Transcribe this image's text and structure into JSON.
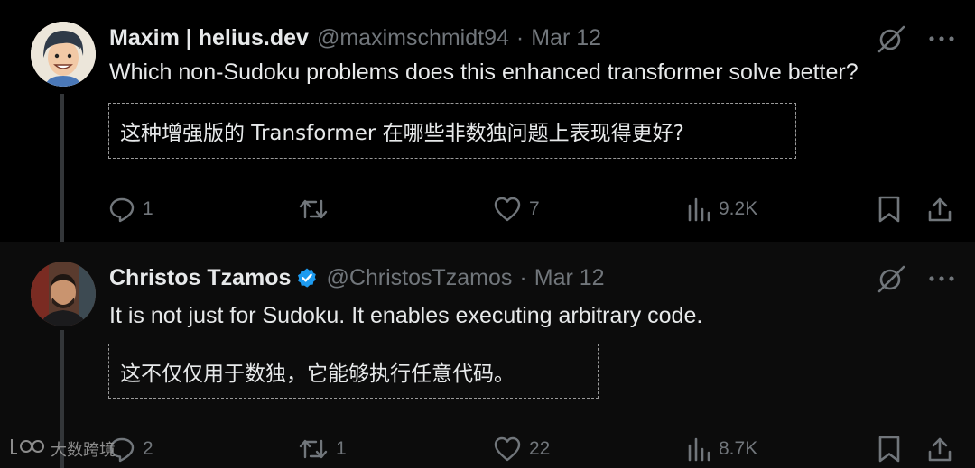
{
  "tweets": [
    {
      "author": {
        "name": "Maxim | helius.dev",
        "handle": "@maximschmidt94",
        "avatar": "cartoon-avatar"
      },
      "separator": "·",
      "date": "Mar 12",
      "text": "Which non-Sudoku problems does this enhanced transformer solve better?",
      "translation": "这种增强版的 Transformer 在哪些非数独问题上表现得更好?",
      "stats": {
        "replies": "1",
        "reposts": "",
        "likes": "7",
        "views": "9.2K"
      }
    },
    {
      "author": {
        "name": "Christos Tzamos",
        "handle": "@ChristosTzamos",
        "verified": true,
        "avatar": "photo-avatar"
      },
      "separator": "·",
      "date": "Mar 12",
      "text": "It is not just for Sudoku. It enables executing arbitrary code.",
      "translation": "这不仅仅用于数独，它能够执行任意代码。",
      "stats": {
        "replies": "2",
        "reposts": "1",
        "likes": "22",
        "views": "8.7K"
      }
    }
  ],
  "watermark": {
    "text": "大数跨境"
  },
  "colors": {
    "background": "#000000",
    "text": "#e7e9ea",
    "muted": "#71767b",
    "verified": "#1d9bf0"
  }
}
